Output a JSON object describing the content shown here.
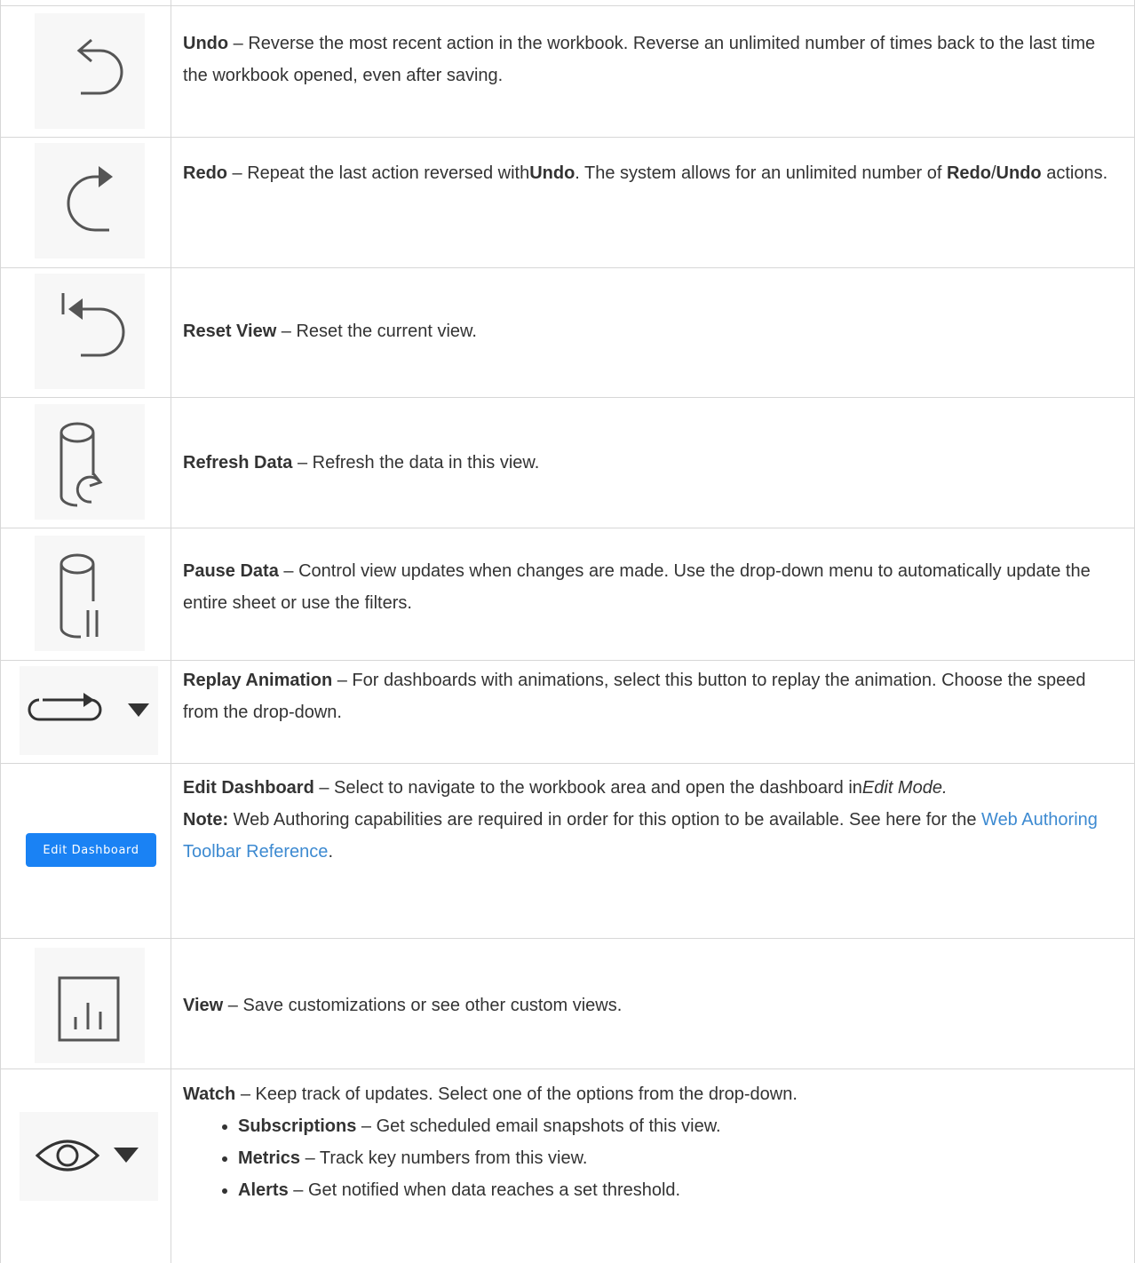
{
  "rows": [
    {
      "title": "Undo",
      "desc_a": " – Reverse the most recent action in the workbook. Reverse an unlimited number of times back to the last time the workbook opened, even after saving."
    },
    {
      "title": "Redo",
      "desc_a": " – Repeat the last action reversed with",
      "bold_b": "Undo",
      "desc_c": ". The system allows for an unlimited number of ",
      "bold_d": "Redo",
      "desc_e": "/",
      "bold_f": "Undo",
      "desc_g": " actions."
    },
    {
      "title": "Reset View",
      "desc_a": " – Reset the current view."
    },
    {
      "title": "Refresh Data",
      "desc_a": " – Refresh the data in this view."
    },
    {
      "title": "Pause Data",
      "desc_a": " – Control view updates when changes are made. Use the drop-down menu to automatically update the entire sheet or use the filters."
    },
    {
      "title": "Replay Animation",
      "desc_a": " – For dashboards with animations, select this button to replay the animation. Choose the speed from the drop-down."
    },
    {
      "title": "Edit Dashboard",
      "desc_a": " – Select to navigate to the workbook area and open the dashboard in",
      "italic_b": "Edit Mode.",
      "note_label": "Note:",
      "note_text": " Web Authoring capabilities are required in order for this option to be available. See here for the",
      "link_text": "Web Authoring Toolbar Reference",
      "note_end": ".",
      "button_label": "Edit Dashboard"
    },
    {
      "title": "View",
      "desc_a": " – Save customizations or see other custom views."
    },
    {
      "title": "Watch",
      "desc_a": " – Keep track of updates. Select one of the options from the drop-down.",
      "items": [
        {
          "label": "Subscriptions",
          "text": " – Get scheduled email snapshots of this view."
        },
        {
          "label": "Metrics",
          "text": " – Track key numbers from this view."
        },
        {
          "label": "Alerts",
          "text": " – Get notified when data reaches a set threshold."
        }
      ]
    }
  ],
  "colors": {
    "border": "#d7d7d7",
    "icon_bg": "#f7f7f7",
    "icon_stroke": "#555555",
    "button_bg": "#1a82f4",
    "link": "#3d8ad1"
  },
  "icons": [
    "undo-icon",
    "redo-icon",
    "reset-view-icon",
    "refresh-data-icon",
    "pause-data-icon",
    "replay-animation-icon",
    "edit-dashboard-button",
    "view-icon",
    "watch-icon"
  ]
}
